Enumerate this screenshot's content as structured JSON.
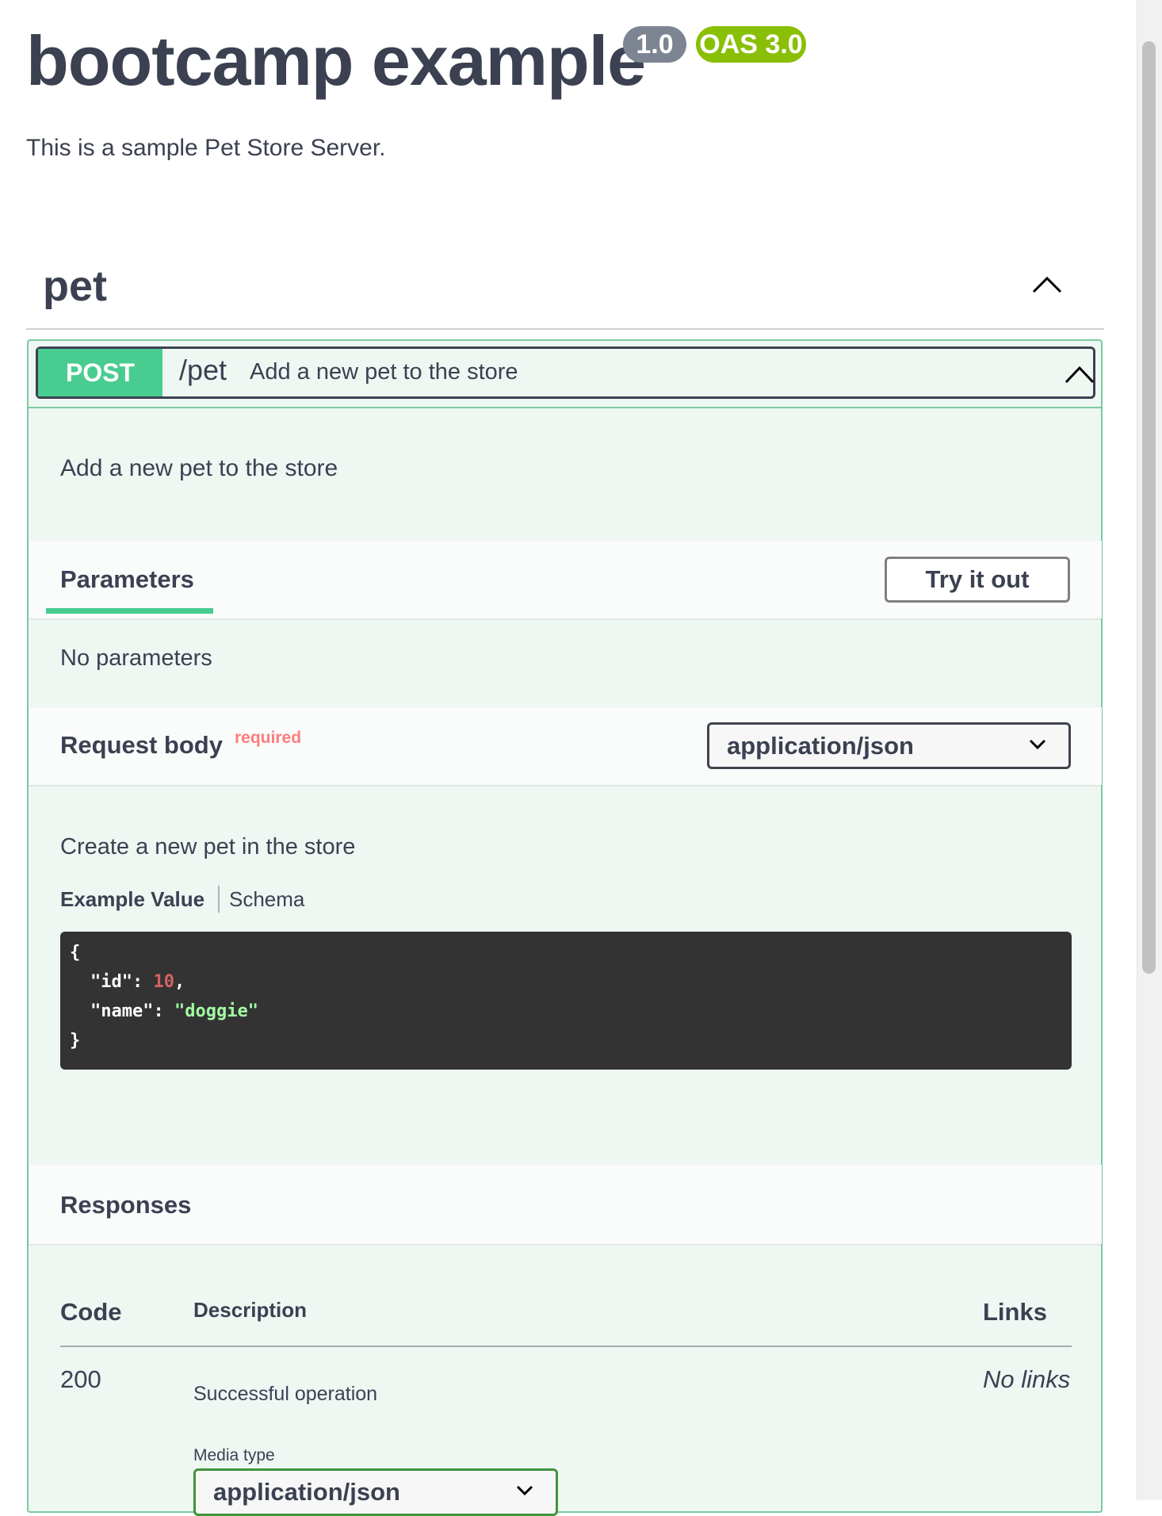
{
  "header": {
    "title": "bootcamp example",
    "version_badge": "1.0",
    "oas_badge": "OAS 3.0",
    "description": "This is a sample Pet Store Server."
  },
  "tag": {
    "name": "pet"
  },
  "operation": {
    "method": "POST",
    "path": "/pet",
    "summary": "Add a new pet to the store",
    "description": "Add a new pet to the store",
    "parameters_tab": "Parameters",
    "try_it_out_label": "Try it out",
    "no_parameters": "No parameters",
    "request_body": {
      "title": "Request body",
      "required_label": "required",
      "content_type": "application/json",
      "description": "Create a new pet in the store",
      "example_tab": "Example Value",
      "schema_tab": "Schema",
      "example_lines": {
        "open": "{",
        "id_key": "\"id\"",
        "id_value": "10",
        "name_key": "\"name\"",
        "name_value": "\"doggie\"",
        "close": "}"
      }
    },
    "responses": {
      "title": "Responses",
      "columns": {
        "code": "Code",
        "description": "Description",
        "links": "Links"
      },
      "rows": [
        {
          "code": "200",
          "description": "Successful operation",
          "links": "No links",
          "media_type_label": "Media type",
          "media_type": "application/json"
        }
      ]
    }
  },
  "colors": {
    "post_green": "#49cc90",
    "opblock_bg": "#eff7f3",
    "version_badge": "#7d8492",
    "oas_badge": "#89bf04",
    "required_red": "#ff6f6f",
    "code_bg": "#333333"
  },
  "icons": {
    "tag_toggle": "chevron-up-icon",
    "operation_toggle": "chevron-up-icon",
    "select_arrow": "chevron-down-icon"
  }
}
